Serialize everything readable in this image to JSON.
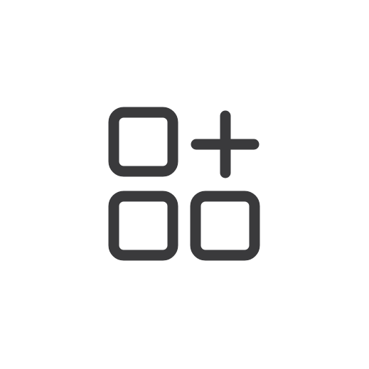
{
  "icon": {
    "name": "add-app-icon",
    "color": "#3a3a3c",
    "background": "#ffffff"
  }
}
